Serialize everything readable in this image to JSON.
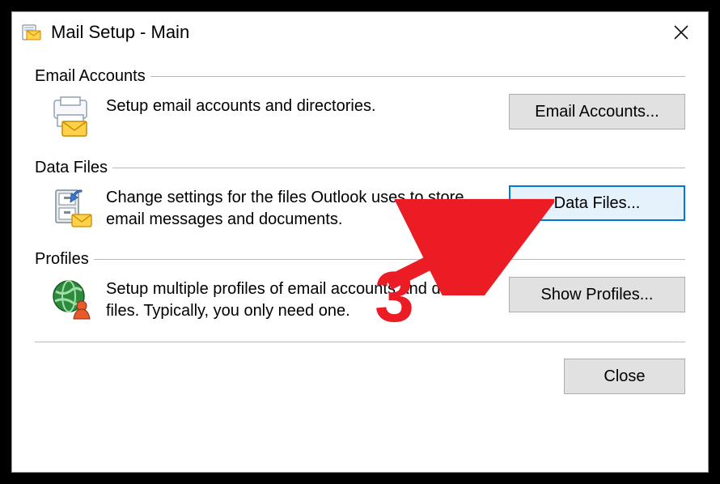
{
  "title": "Mail Setup - Main",
  "sections": {
    "email": {
      "label": "Email Accounts",
      "desc": "Setup email accounts and directories.",
      "button": "Email Accounts..."
    },
    "data": {
      "label": "Data Files",
      "desc": "Change settings for the files Outlook uses to store email messages and documents.",
      "button": "Data Files..."
    },
    "profiles": {
      "label": "Profiles",
      "desc": "Setup multiple profiles of email accounts and data files. Typically, you only need one.",
      "button": "Show Profiles..."
    }
  },
  "close": "Close",
  "annotation": "3"
}
